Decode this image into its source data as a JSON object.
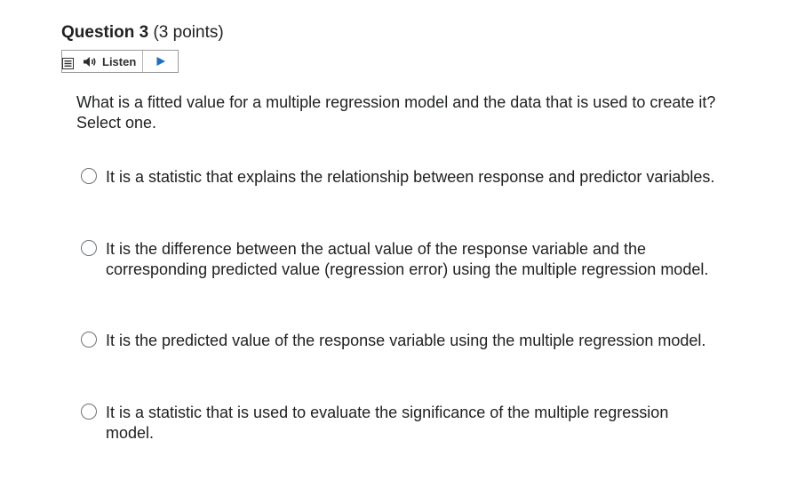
{
  "question": {
    "title": "Question 3",
    "points": "(3 points)"
  },
  "listen": {
    "label": "Listen"
  },
  "prompt": "What is a fitted value for a multiple regression model and the data that is used to create it? Select one.",
  "options": [
    {
      "label": "It is a statistic that explains the relationship between response and predictor variables.",
      "selected": false
    },
    {
      "label": "It is the difference between the actual value of the response variable and the corresponding predicted value (regression error) using the multiple regression model.",
      "selected": false
    },
    {
      "label": "It is the predicted value of the response variable using the multiple regression model.",
      "selected": false
    },
    {
      "label": "It is a statistic that is used to evaluate the significance of the multiple regression model.",
      "selected": false
    }
  ]
}
